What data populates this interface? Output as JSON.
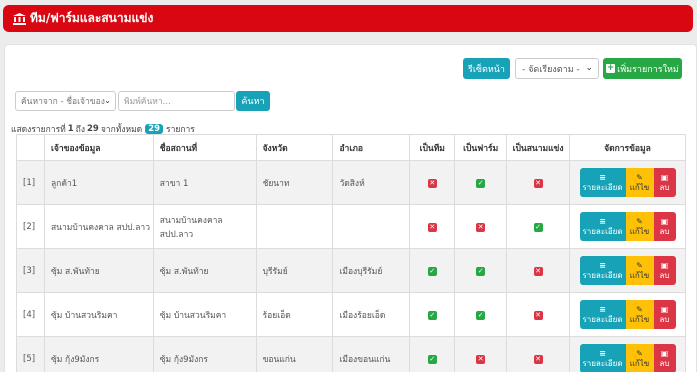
{
  "header": {
    "title": "ทีม/ฟาร์มและสนามแข่ง",
    "icon": "bank-icon",
    "color": "#d90712"
  },
  "toolbar": {
    "reset_label": "รีเซ็ตหน้า",
    "sort_placeholder": "- จัดเรียงตาม -",
    "add_label": "เพิ่มรายการใหม่"
  },
  "search": {
    "field_select": "ค้นหาจาก - ชื่อเจ้าของ",
    "placeholder": "พิมพ์ค้นหา...",
    "button": "ค้นหา"
  },
  "summary": {
    "prefix": "แสดงรายการที่",
    "from": "1",
    "to_word": "ถึง",
    "to": "29",
    "of_word": "จากทั้งหมด",
    "total": "29",
    "suffix": "รายการ"
  },
  "table": {
    "columns": [
      "",
      "เจ้าของข้อมูล",
      "ชื่อสถานที่",
      "จังหวัด",
      "อำเภอ",
      "เป็นทีม",
      "เป็นฟาร์ม",
      "เป็นสนามแข่ง",
      "จัดการข้อมูล"
    ],
    "actions": {
      "detail": "รายละเอียด",
      "edit": "แก้ไข",
      "delete": "ลบ"
    },
    "rows": [
      {
        "no": "[1]",
        "owner": "ลูกค้า1",
        "place": "สาขา 1",
        "province": "ชัยนาท",
        "district": "วัดสิงห์",
        "team": false,
        "farm": true,
        "stadium": false
      },
      {
        "no": "[2]",
        "owner": "สนามบ้านคงคาล สปป.ลาว",
        "place": "สนามบ้านคงคาล สปป.ลาว",
        "province": "",
        "district": "",
        "team": false,
        "farm": false,
        "stadium": true
      },
      {
        "no": "[3]",
        "owner": "ซุ้ม ส.พันท้าย",
        "place": "ซุ้ม ส.พันท้าย",
        "province": "บุรีรัมย์",
        "district": "เมืองบุรีรัมย์",
        "team": true,
        "farm": true,
        "stadium": false
      },
      {
        "no": "[4]",
        "owner": "ซุ้ม บ้านสวนริมคา",
        "place": "ซุ้ม บ้านสวนริมคา",
        "province": "ร้อยเอ็ด",
        "district": "เมืองร้อยเอ็ด",
        "team": true,
        "farm": true,
        "stadium": false
      },
      {
        "no": "[5]",
        "owner": "ซุ้ม กุ้ง9มังกร",
        "place": "ซุ้ม กุ้ง9มังกร",
        "province": "ขอนแก่น",
        "district": "เมืองขอนแก่น",
        "team": true,
        "farm": false,
        "stadium": false
      }
    ]
  }
}
